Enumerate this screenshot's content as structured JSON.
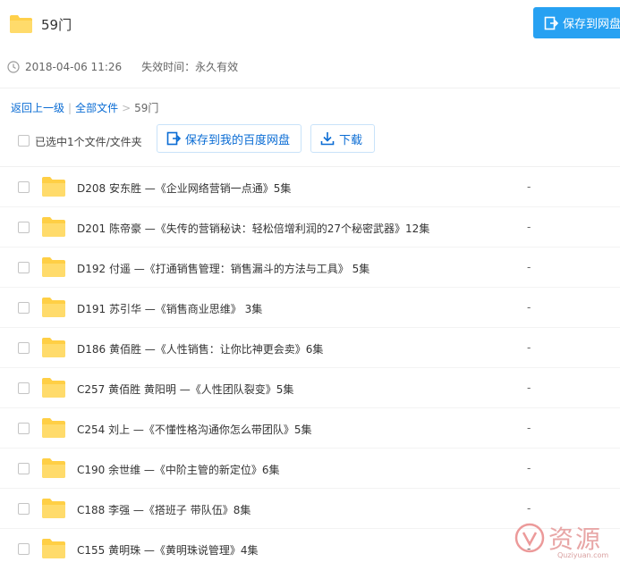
{
  "header": {
    "title": "59门",
    "save_button": "保存到网盘"
  },
  "meta": {
    "date": "2018-04-06 11:26",
    "expire": "失效时间：永久有效"
  },
  "breadcrumb": {
    "back": "返回上一级",
    "sep": "|",
    "all": "全部文件",
    "arrow": ">",
    "current": "59门"
  },
  "actions": {
    "selected_label": "已选中1个文件/文件夹",
    "save_button": "保存到我的百度网盘",
    "download_button": "下载"
  },
  "files": [
    {
      "name": "D208 安东胜 —《企业网络营销一点通》5集",
      "size": "-"
    },
    {
      "name": "D201 陈帝豪 —《失传的营销秘诀：轻松倍增利润的27个秘密武器》12集",
      "size": "-"
    },
    {
      "name": "D192 付遥 —《打通销售管理：销售漏斗的方法与工具》 5集",
      "size": "-"
    },
    {
      "name": "D191 苏引华 —《销售商业思维》 3集",
      "size": "-"
    },
    {
      "name": "D186 黄佰胜 —《人性销售：让你比神更会卖》6集",
      "size": "-"
    },
    {
      "name": "C257 黄佰胜 黄阳明 —《人性团队裂变》5集",
      "size": "-"
    },
    {
      "name": "C254 刘上 —《不懂性格沟通你怎么带团队》5集",
      "size": "-"
    },
    {
      "name": "C190 余世维 —《中阶主管的新定位》6集",
      "size": "-"
    },
    {
      "name": "C188 李强 —《搭班子 带队伍》8集",
      "size": "-"
    },
    {
      "name": "C155 黄明珠 —《黄明珠说管理》4集",
      "size": "-"
    }
  ],
  "watermark": {
    "text": "资源",
    "sub": "Quziyuan.com"
  },
  "colors": {
    "accent": "#27a1f2",
    "link": "#0a6cd4",
    "folder": "#ffd659"
  }
}
